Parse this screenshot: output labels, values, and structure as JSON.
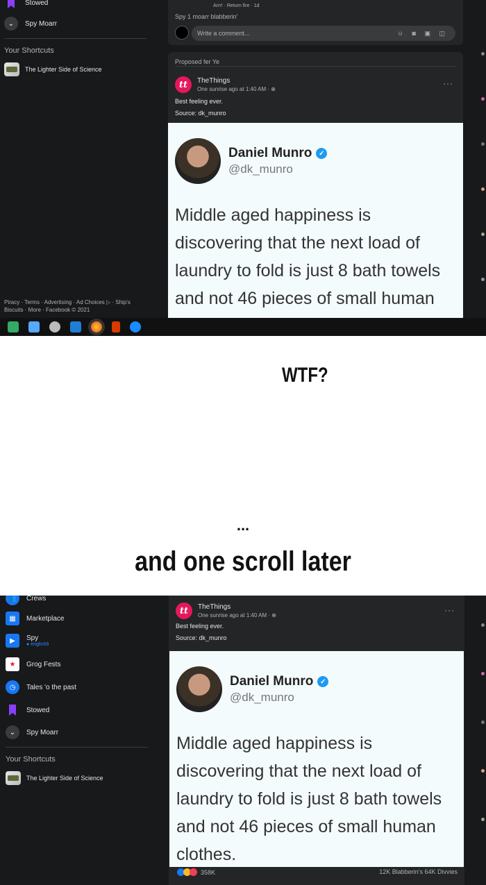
{
  "top": {
    "sidebar": {
      "stowed_label": "Stowed",
      "spy_moarr_label": "Spy Moarr",
      "shortcuts_heading": "Your Shortcuts",
      "shortcut_label": "The Lighter Side of Science",
      "footer": "Piracy · Terms · Advertising · Ad Choices ▷ · Ship's Biscuits · More · Facebook © 2021"
    },
    "prev_post": {
      "actions": "Arrr! · Return fire · 1d",
      "spy_more": "Spy 1 moarr blabberin'",
      "comment_placeholder": "Write a comment..."
    },
    "post": {
      "proposed": "Proposed fer Ye",
      "author": "TheThings",
      "meta": "One sunrise ago at 1:40 AM · ⊕",
      "text1": "Best feeling ever.",
      "text2": "Source: dk_munro",
      "more": "···"
    }
  },
  "tweet": {
    "name": "Daniel Munro",
    "handle": "@dk_munro",
    "lines": [
      "Middle aged happiness is",
      "discovering that the next load of",
      "laundry to fold is just 8 bath towels",
      "and not 46 pieces of small human",
      "clothes."
    ]
  },
  "meme": {
    "wtf": "WTF?",
    "ellipsis": "...",
    "caption": "and one scroll later"
  },
  "bottom": {
    "sidebar": {
      "crews_label": "Crews",
      "marketplace_label": "Marketplace",
      "spy_label": "Spy",
      "spy_sub": "● english9",
      "grog_label": "Grog Fests",
      "tales_label": "Tales 'o the past",
      "stowed_label": "Stowed",
      "spy_moarr_label": "Spy Moarr",
      "shortcuts_heading": "Your Shortcuts",
      "shortcut_label": "The Lighter Side of Science"
    },
    "post": {
      "author": "TheThings",
      "meta": "One sunrise ago at 1:40 AM · ⊕",
      "text1": "Best feeling ever.",
      "text2": "Source: dk_munro",
      "more": "···",
      "reactions_count": "358K",
      "stats": "12K Blabberin's  64K Divvies"
    }
  },
  "colors": {
    "bg_dark": "#18191a",
    "card": "#242526",
    "brand_pink": "#e5185c",
    "verified_blue": "#1d9bf0"
  }
}
